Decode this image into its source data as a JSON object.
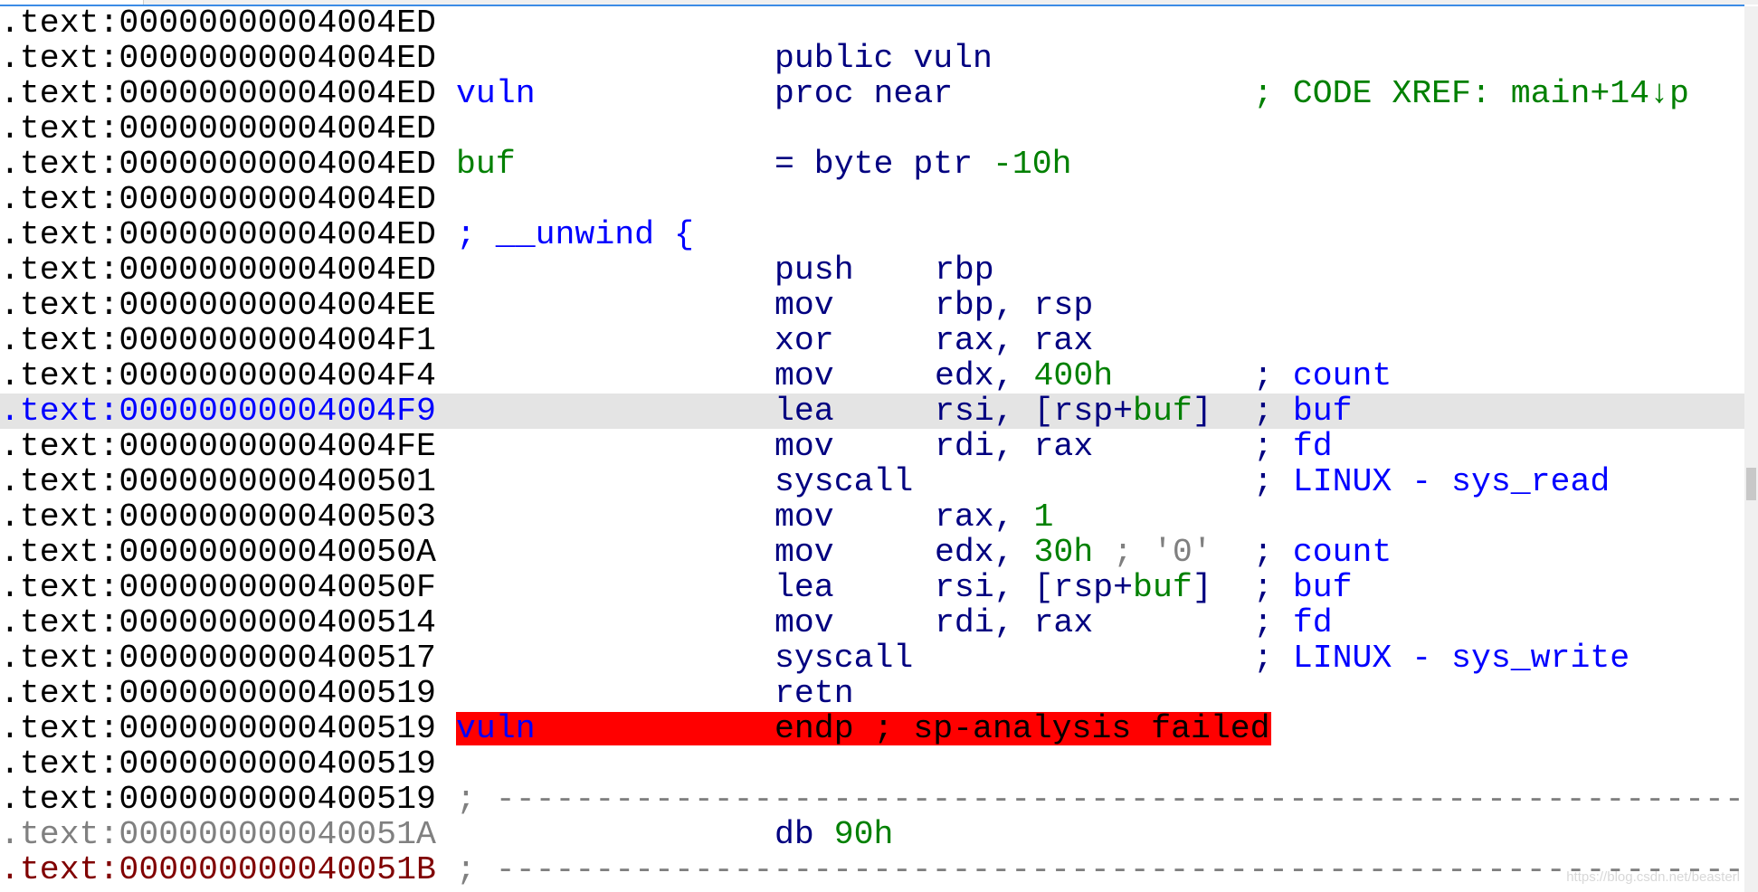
{
  "colors": {
    "addr": "#000000",
    "addr_current": "#0000ff",
    "addr_unexplored": "#808080",
    "addr_dark": "#800000",
    "label": "#0000ff",
    "var": "#008000",
    "mnem": "#000080",
    "num": "#008000",
    "xref": "#008000",
    "semi": "#000080",
    "cmt": "#0000ff",
    "grey": "#808080",
    "err_bg": "#ff0000",
    "err_text": "#000000",
    "highlight_bg": "#e4e4e4"
  },
  "rows": [
    {
      "addr": ".text:00000000004004ED"
    },
    {
      "addr": ".text:00000000004004ED",
      "mnem": [
        [
          "public vuln",
          "mnem"
        ]
      ]
    },
    {
      "addr": ".text:00000000004004ED",
      "name": [
        [
          "vuln",
          "label"
        ]
      ],
      "mnem": [
        [
          "proc near",
          "mnem"
        ]
      ],
      "cmt": [
        [
          "; CODE XREF: main+14↓p",
          "xref"
        ]
      ]
    },
    {
      "addr": ".text:00000000004004ED"
    },
    {
      "addr": ".text:00000000004004ED",
      "name": [
        [
          "buf",
          "var"
        ]
      ],
      "mnem": [
        [
          "= byte ptr ",
          "mnem"
        ],
        [
          "-10h",
          "num"
        ]
      ]
    },
    {
      "addr": ".text:00000000004004ED"
    },
    {
      "addr": ".text:00000000004004ED",
      "name": [
        [
          "; __unwind {",
          "label"
        ]
      ]
    },
    {
      "addr": ".text:00000000004004ED",
      "mnem": [
        [
          "push",
          "mnem"
        ]
      ],
      "ops": [
        [
          "rbp",
          "mnem"
        ]
      ]
    },
    {
      "addr": ".text:00000000004004EE",
      "mnem": [
        [
          "mov",
          "mnem"
        ]
      ],
      "ops": [
        [
          "rbp, rsp",
          "mnem"
        ]
      ]
    },
    {
      "addr": ".text:00000000004004F1",
      "mnem": [
        [
          "xor",
          "mnem"
        ]
      ],
      "ops": [
        [
          "rax, rax",
          "mnem"
        ]
      ]
    },
    {
      "addr": ".text:00000000004004F4",
      "mnem": [
        [
          "mov",
          "mnem"
        ]
      ],
      "ops": [
        [
          "edx, ",
          "mnem"
        ],
        [
          "400h",
          "num"
        ]
      ],
      "cmt": [
        [
          "; ",
          "semi"
        ],
        [
          "count",
          "cmt"
        ]
      ]
    },
    {
      "addr": ".text:00000000004004F9",
      "addr_color": "addr_current",
      "highlight": true,
      "mnem": [
        [
          "lea",
          "mnem"
        ]
      ],
      "ops": [
        [
          "rsi, [rsp+",
          "mnem"
        ],
        [
          "buf",
          "var"
        ],
        [
          "]",
          "mnem"
        ]
      ],
      "cmt": [
        [
          "; ",
          "semi"
        ],
        [
          "buf",
          "cmt"
        ]
      ]
    },
    {
      "addr": ".text:00000000004004FE",
      "mnem": [
        [
          "mov",
          "mnem"
        ]
      ],
      "ops": [
        [
          "rdi, rax",
          "mnem"
        ]
      ],
      "cmt": [
        [
          "; ",
          "semi"
        ],
        [
          "fd",
          "cmt"
        ]
      ]
    },
    {
      "addr": ".text:0000000000400501",
      "mnem": [
        [
          "syscall",
          "mnem"
        ]
      ],
      "cmt": [
        [
          "; ",
          "semi"
        ],
        [
          "LINUX - sys_read",
          "cmt"
        ]
      ]
    },
    {
      "addr": ".text:0000000000400503",
      "mnem": [
        [
          "mov",
          "mnem"
        ]
      ],
      "ops": [
        [
          "rax, ",
          "mnem"
        ],
        [
          "1",
          "num"
        ]
      ]
    },
    {
      "addr": ".text:000000000040050A",
      "mnem": [
        [
          "mov",
          "mnem"
        ]
      ],
      "ops": [
        [
          "edx, ",
          "mnem"
        ],
        [
          "30h",
          "num"
        ],
        [
          " ; '0'",
          "grey"
        ]
      ],
      "cmt": [
        [
          "; ",
          "semi"
        ],
        [
          "count",
          "cmt"
        ]
      ]
    },
    {
      "addr": ".text:000000000040050F",
      "mnem": [
        [
          "lea",
          "mnem"
        ]
      ],
      "ops": [
        [
          "rsi, [rsp+",
          "mnem"
        ],
        [
          "buf",
          "var"
        ],
        [
          "]",
          "mnem"
        ]
      ],
      "cmt": [
        [
          "; ",
          "semi"
        ],
        [
          "buf",
          "cmt"
        ]
      ]
    },
    {
      "addr": ".text:0000000000400514",
      "mnem": [
        [
          "mov",
          "mnem"
        ]
      ],
      "ops": [
        [
          "rdi, rax",
          "mnem"
        ]
      ],
      "cmt": [
        [
          "; ",
          "semi"
        ],
        [
          "fd",
          "cmt"
        ]
      ]
    },
    {
      "addr": ".text:0000000000400517",
      "mnem": [
        [
          "syscall",
          "mnem"
        ]
      ],
      "cmt": [
        [
          "; ",
          "semi"
        ],
        [
          "LINUX - sys_write",
          "cmt"
        ]
      ]
    },
    {
      "addr": ".text:0000000000400519",
      "mnem": [
        [
          "retn",
          "mnem"
        ]
      ]
    },
    {
      "addr": ".text:0000000000400519",
      "error": true,
      "name": [
        [
          "vuln",
          "label"
        ]
      ],
      "mnem": [
        [
          "endp ; sp-analysis failed",
          "err_text"
        ]
      ]
    },
    {
      "addr": ".text:0000000000400519"
    },
    {
      "addr": ".text:0000000000400519",
      "dash": true,
      "name": [
        [
          "; ---------------------------------------------------------------------",
          "grey"
        ]
      ]
    },
    {
      "addr": ".text:000000000040051A",
      "addr_color": "addr_unexplored",
      "mnem": [
        [
          "db ",
          "mnem"
        ],
        [
          "90h",
          "num"
        ]
      ]
    },
    {
      "addr": ".text:000000000040051B",
      "addr_color": "addr_dark",
      "dash": true,
      "name": [
        [
          "; ---------------------------------------------------------------------",
          "grey"
        ]
      ]
    }
  ],
  "watermark": "https://blog.csdn.net/beasterl"
}
